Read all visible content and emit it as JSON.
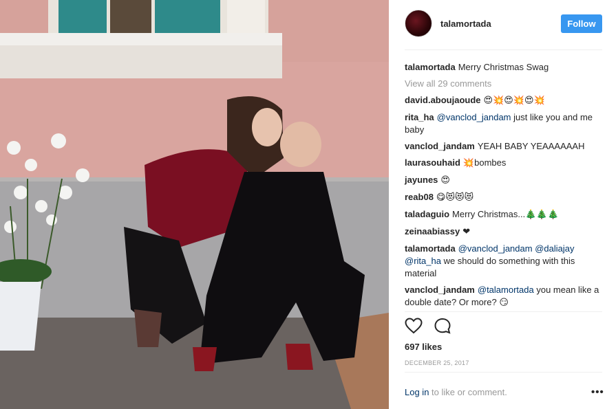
{
  "post": {
    "photo_alt": "",
    "header": {
      "username": "talamortada",
      "follow_label": "Follow"
    },
    "caption": {
      "user": "talamortada",
      "text": "Merry Christmas Swag"
    },
    "view_all": "View all 29 comments",
    "comments": [
      {
        "user": "david.aboujaoude",
        "parts": [
          {
            "t": "emoji",
            "v": "😍💥😍💥😍💥"
          }
        ]
      },
      {
        "user": "rita_ha",
        "parts": [
          {
            "t": "mention",
            "v": "@vanclod_jandam"
          },
          {
            "t": "text",
            "v": " just like you and me baby"
          }
        ]
      },
      {
        "user": "vanclod_jandam",
        "parts": [
          {
            "t": "text",
            "v": "YEAH BABY YEAAAAAAH"
          }
        ]
      },
      {
        "user": "laurasouhaid",
        "parts": [
          {
            "t": "emoji",
            "v": "💥"
          },
          {
            "t": "text",
            "v": "bombes"
          }
        ]
      },
      {
        "user": "jayunes",
        "parts": [
          {
            "t": "emoji",
            "v": "😍"
          }
        ]
      },
      {
        "user": "reab08",
        "parts": [
          {
            "t": "emoji",
            "v": "😋😻😻😻"
          }
        ]
      },
      {
        "user": "taladaguio",
        "parts": [
          {
            "t": "text",
            "v": "Merry Christmas..."
          },
          {
            "t": "emoji",
            "v": "🎄🎄🎄"
          }
        ]
      },
      {
        "user": "zeinaabiassy",
        "parts": [
          {
            "t": "emoji",
            "v": "❤"
          }
        ]
      },
      {
        "user": "talamortada",
        "parts": [
          {
            "t": "mention",
            "v": "@vanclod_jandam"
          },
          {
            "t": "text",
            "v": " "
          },
          {
            "t": "mention",
            "v": "@daliajay"
          },
          {
            "t": "text",
            "v": " "
          },
          {
            "t": "mention",
            "v": "@rita_ha"
          },
          {
            "t": "text",
            "v": " we should do something with this material"
          }
        ]
      },
      {
        "user": "vanclod_jandam",
        "parts": [
          {
            "t": "mention",
            "v": "@talamortada"
          },
          {
            "t": "text",
            "v": " you mean like a double date? Or more? "
          },
          {
            "t": "emoji",
            "v": "😏"
          }
        ]
      }
    ],
    "icons": {
      "like": "heart-icon",
      "comment": "comment-bubble-icon",
      "more": "more-options-icon"
    },
    "likes": "697 likes",
    "date": "DECEMBER 25, 2017",
    "footer": {
      "login_label": "Log in",
      "rest": " to like or comment.",
      "more_label": "•••"
    },
    "colors": {
      "accent": "#3897f0",
      "mention": "#003569",
      "muted": "#999999",
      "wall": "#d9a7a0"
    }
  }
}
